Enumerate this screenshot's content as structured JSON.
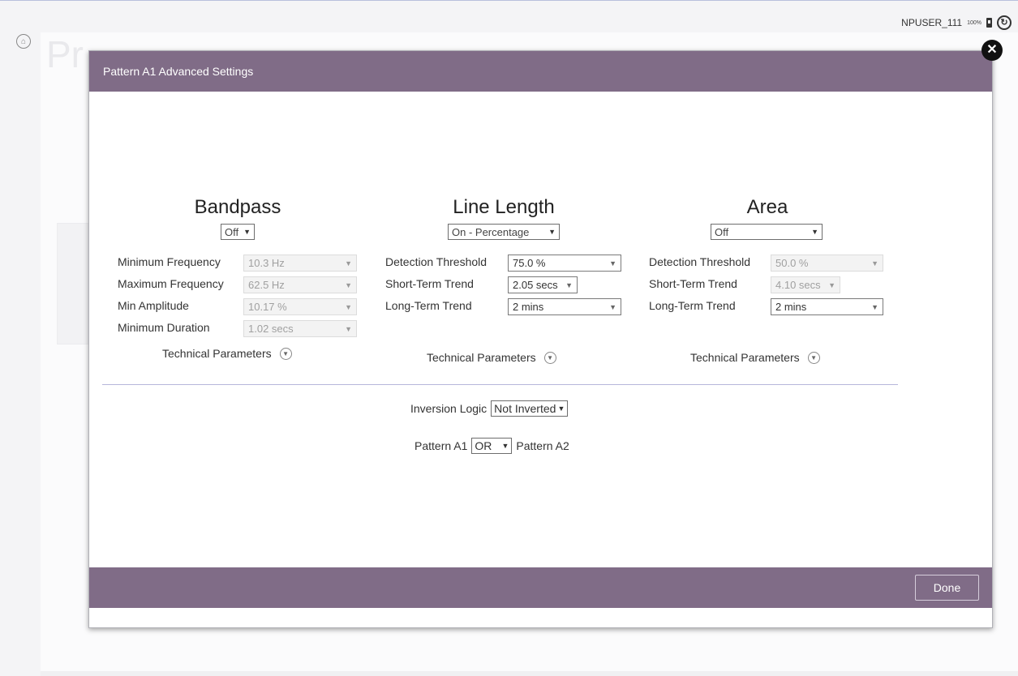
{
  "topbar": {
    "username": "NPUSER_111",
    "battery_text": "100%",
    "battery_icon": "battery-icon",
    "sync_icon": "sync-icon"
  },
  "background": {
    "home_icon": "home-icon",
    "page_title_fragment": "Pr"
  },
  "modal": {
    "title": "Pattern A1 Advanced Settings",
    "close_icon": "close-icon",
    "done_label": "Done"
  },
  "bandpass": {
    "title": "Bandpass",
    "mode": "Off",
    "rows": [
      {
        "label": "Minimum Frequency",
        "value": "10.3 Hz"
      },
      {
        "label": "Maximum Frequency",
        "value": "62.5 Hz"
      },
      {
        "label": "Min Amplitude",
        "value": "10.17 %"
      },
      {
        "label": "Minimum Duration",
        "value": "1.02 secs"
      }
    ],
    "technical_label": "Technical Parameters"
  },
  "line_length": {
    "title": "Line Length",
    "mode": "On - Percentage",
    "rows": [
      {
        "label": "Detection Threshold",
        "value": "75.0 %"
      },
      {
        "label": "Short-Term Trend",
        "value": "2.05 secs"
      },
      {
        "label": "Long-Term Trend",
        "value": "2 mins"
      }
    ],
    "technical_label": "Technical Parameters"
  },
  "area": {
    "title": "Area",
    "mode": "Off",
    "rows": [
      {
        "label": "Detection Threshold",
        "value": "50.0 %"
      },
      {
        "label": "Short-Term Trend",
        "value": "4.10 secs"
      },
      {
        "label": "Long-Term Trend",
        "value": "2 mins"
      }
    ],
    "technical_label": "Technical Parameters"
  },
  "inversion": {
    "label": "Inversion Logic",
    "value": "Not Inverted"
  },
  "combination": {
    "left_label": "Pattern A1",
    "operator": "OR",
    "right_label": "Pattern A2"
  },
  "colors": {
    "header": "#806c87",
    "divider": "#b6b6da"
  }
}
